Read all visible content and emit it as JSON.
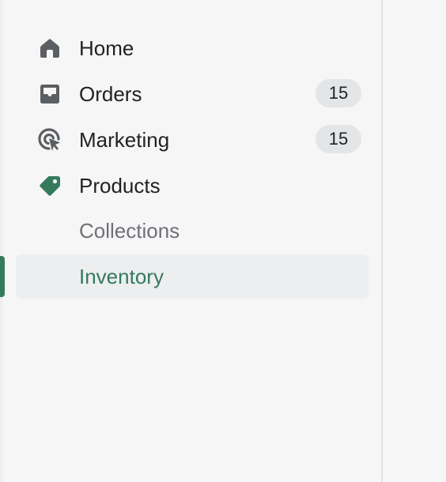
{
  "nav": {
    "items": [
      {
        "label": "Home",
        "icon": "home-icon"
      },
      {
        "label": "Orders",
        "icon": "inbox-icon",
        "badge": "15"
      },
      {
        "label": "Marketing",
        "icon": "target-cursor-icon",
        "badge": "15"
      },
      {
        "label": "Products",
        "icon": "tag-icon",
        "icon_color": "#357a5d"
      }
    ],
    "sub_items": [
      {
        "label": "Collections",
        "active": false
      },
      {
        "label": "Inventory",
        "active": true
      }
    ]
  },
  "colors": {
    "accent": "#357a5d",
    "icon": "#5c5f62",
    "badge_bg": "#e4e5e7",
    "active_bg": "#edeeef"
  }
}
